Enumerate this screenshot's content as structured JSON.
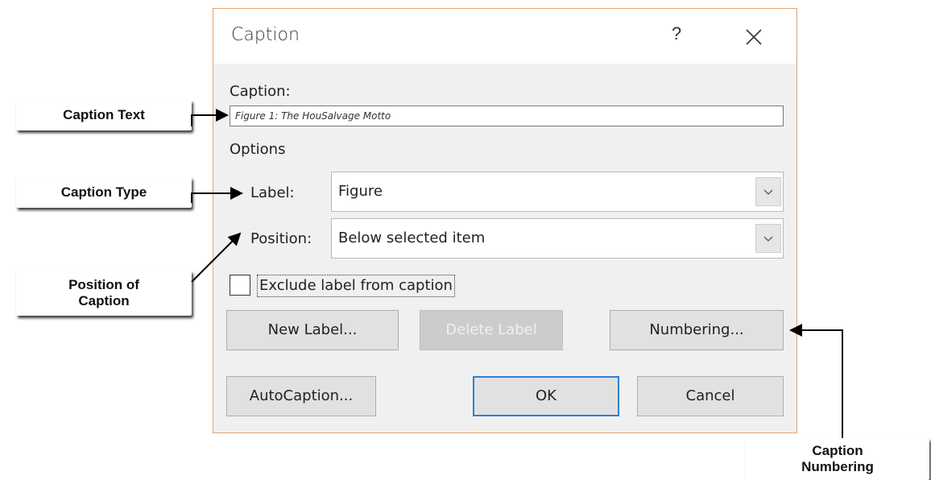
{
  "dialog": {
    "title": "Caption",
    "help_glyph": "?",
    "caption_label": "Caption:",
    "caption_value": "Figure 1: The HouSalvage Motto",
    "options_label": "Options",
    "label_label": "Label:",
    "label_value": "Figure",
    "position_label": "Position:",
    "position_value": "Below selected item",
    "exclude_label": "Exclude label from caption",
    "exclude_checked": false,
    "buttons": {
      "new_label": "New Label...",
      "delete_label": "Delete Label",
      "numbering": "Numbering...",
      "autocaption": "AutoCaption...",
      "ok": "OK",
      "cancel": "Cancel"
    },
    "accent_color": "#2f7fd1",
    "border_color": "#e5a36f"
  },
  "callouts": {
    "caption_text": "Caption Text",
    "caption_type": "Caption Type",
    "position_of_caption_line1": "Position of",
    "position_of_caption_line2": "Caption",
    "caption_numbering_line1": "Caption",
    "caption_numbering_line2": "Numbering"
  },
  "icons": [
    "help-icon",
    "close-icon",
    "chevron-down-icon",
    "arrow-icon"
  ]
}
